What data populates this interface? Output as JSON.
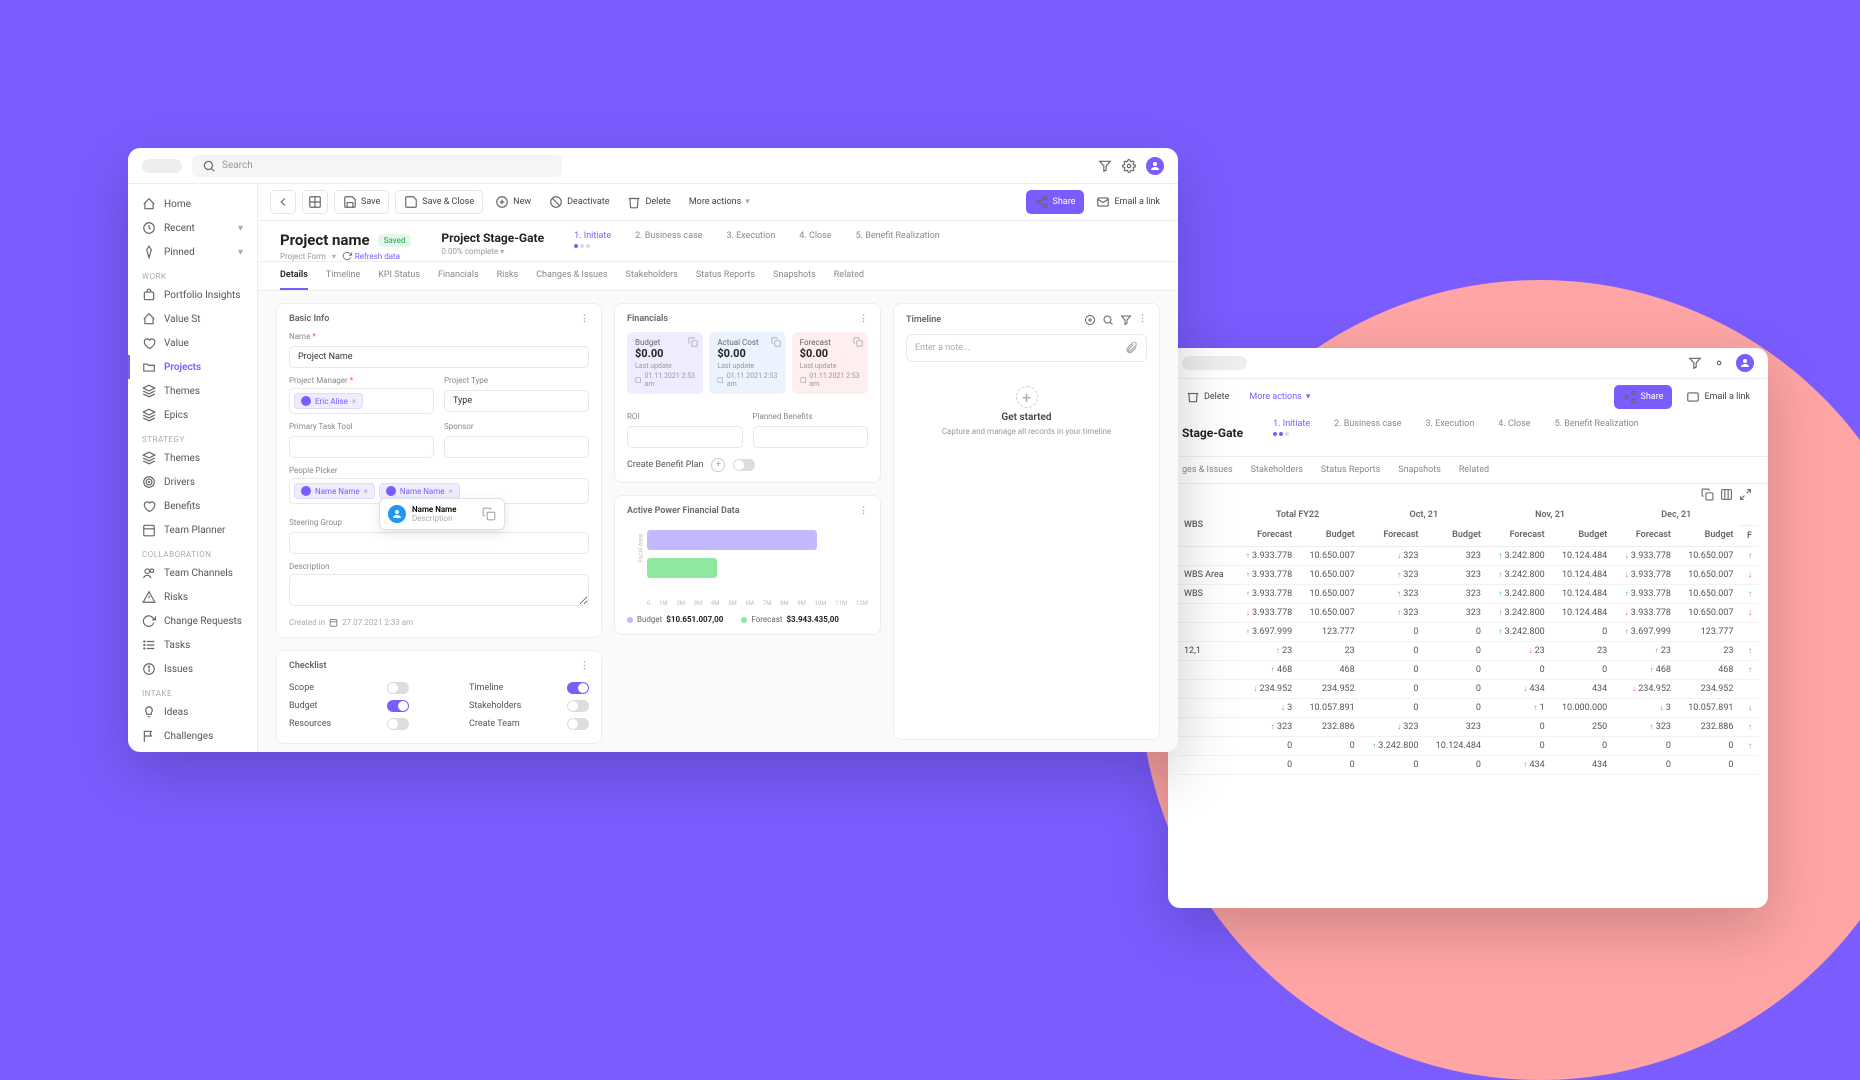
{
  "colors": {
    "accent": "#7b5cff",
    "pink": "#ffa5a5",
    "green": "#3db56a",
    "red": "#f55"
  },
  "topbar": {
    "search_placeholder": "Search"
  },
  "sidebar": {
    "top": [
      {
        "icon": "home",
        "label": "Home"
      },
      {
        "icon": "clock",
        "label": "Recent",
        "chevron": true
      },
      {
        "icon": "pin",
        "label": "Pinned",
        "chevron": true
      }
    ],
    "sections": [
      {
        "title": "WORK",
        "items": [
          {
            "icon": "bag",
            "label": "Portfolio Insights"
          },
          {
            "icon": "home",
            "label": "Value St"
          },
          {
            "icon": "heart",
            "label": "Value"
          },
          {
            "icon": "folder",
            "label": "Projects",
            "active": true
          },
          {
            "icon": "stack",
            "label": "Themes"
          },
          {
            "icon": "stack",
            "label": "Epics"
          }
        ]
      },
      {
        "title": "STRATEGY",
        "items": [
          {
            "icon": "stack",
            "label": "Themes"
          },
          {
            "icon": "target",
            "label": "Drivers"
          },
          {
            "icon": "heart",
            "label": "Benefits"
          },
          {
            "icon": "calendar",
            "label": "Team Planner"
          }
        ]
      },
      {
        "title": "COLLABORATION",
        "items": [
          {
            "icon": "users",
            "label": "Team Channels"
          },
          {
            "icon": "warn",
            "label": "Risks"
          },
          {
            "icon": "refresh",
            "label": "Change Requests"
          },
          {
            "icon": "list",
            "label": "Tasks"
          },
          {
            "icon": "info",
            "label": "Issues"
          }
        ]
      },
      {
        "title": "INTAKE",
        "items": [
          {
            "icon": "bulb",
            "label": "Ideas"
          },
          {
            "icon": "flag",
            "label": "Challenges"
          }
        ]
      }
    ]
  },
  "toolbar": {
    "save": "Save",
    "save_close": "Save & Close",
    "new": "New",
    "deactivate": "Deactivate",
    "delete": "Delete",
    "more": "More actions",
    "share": "Share",
    "email": "Email a link"
  },
  "header": {
    "title": "Project name",
    "saved_badge": "Saved",
    "form_label": "Project Form",
    "refresh": "Refresh data",
    "stage_title": "Project Stage-Gate",
    "stage_complete": "0.00% complete",
    "stages": [
      "1. Initiate",
      "2. Business case",
      "3. Execution",
      "4. Close",
      "5. Benefit Realization"
    ],
    "active_stage": 0
  },
  "tabs": [
    "Details",
    "Timeline",
    "KPI Status",
    "Financials",
    "Risks",
    "Changes & Issues",
    "Stakeholders",
    "Status Reports",
    "Snapshots",
    "Related"
  ],
  "active_tab": 0,
  "basic_info": {
    "title": "Basic Info",
    "name_label": "Name",
    "name_value": "Project Name",
    "pm_label": "Project Manager",
    "pm_chip": "Eric Alise",
    "type_label": "Project Type",
    "type_value": "Type",
    "task_tool_label": "Primary Task Tool",
    "sponsor_label": "Sponsor",
    "people_label": "People Picker",
    "people_chips": [
      "Name Name",
      "Name Name"
    ],
    "popup": {
      "name": "Name Name",
      "desc": "Description"
    },
    "steering_label": "Steering Group",
    "desc_label": "Description",
    "created_label": "Created in",
    "created_value": "27.07.2021 2:33 am"
  },
  "checklist": {
    "title": "Checklist",
    "rows": [
      {
        "l": "Scope",
        "lon": false,
        "r": "Timeline",
        "ron": true
      },
      {
        "l": "Budget",
        "lon": true,
        "r": "Stakeholders",
        "ron": false
      },
      {
        "l": "Resources",
        "lon": false,
        "r": "Create Team",
        "ron": false
      }
    ]
  },
  "financials": {
    "title": "Financials",
    "cards": [
      {
        "kind": "budget",
        "label": "Budget",
        "value": "$0.00",
        "updated": "01.11.2021  2:53 am"
      },
      {
        "kind": "actual",
        "label": "Actual Cost",
        "value": "$0.00",
        "updated": "01.11.2021  2:53 am"
      },
      {
        "kind": "forecast",
        "label": "Forecast",
        "value": "$0.00",
        "updated": "01.11.2021  2:53 am"
      }
    ],
    "roi_label": "ROI",
    "pb_label": "Planned Benefits",
    "create_benefit": "Create Benefit Plan"
  },
  "active_power": {
    "title": "Active Power Financial Data",
    "budget_label": "Budget",
    "budget_value": "$10.651.007,00",
    "forecast_label": "Forecast",
    "forecast_value": "$3.943.435,00",
    "axis": [
      "0",
      "1M",
      "2M",
      "3M",
      "4M",
      "5M",
      "6M",
      "7M",
      "8M",
      "9M",
      "10M",
      "11M",
      "12M"
    ],
    "ylabel": "Focal Area"
  },
  "chart_data": {
    "type": "bar",
    "orientation": "horizontal",
    "title": "Active Power Financial Data",
    "categories": [
      "Budget",
      "Forecast"
    ],
    "values": [
      10651007,
      3943435
    ],
    "colors": [
      "#c5b8ff",
      "#8ee89e"
    ],
    "xlabel": "",
    "ylabel": "Focal Area",
    "xlim": [
      0,
      12000000
    ],
    "xticks": [
      "0",
      "1M",
      "2M",
      "3M",
      "4M",
      "5M",
      "6M",
      "7M",
      "8M",
      "9M",
      "10M",
      "11M",
      "12M"
    ]
  },
  "timeline": {
    "title": "Timeline",
    "placeholder": "Enter a note...",
    "empty_title": "Get started",
    "empty_sub": "Capture and manage all records in your timeline"
  },
  "back": {
    "toolbar": {
      "delete": "Delete",
      "more": "More actions",
      "share": "Share",
      "email": "Email a link"
    },
    "stage_title": "Stage-Gate",
    "stages": [
      "1. Initiate",
      "2. Business case",
      "3. Execution",
      "4. Close",
      "5. Benefit Realization"
    ],
    "tabs_visible": [
      "ges & Issues",
      "Stakeholders",
      "Status Reports",
      "Snapshots",
      "Related"
    ],
    "grid": {
      "row_header": "WBS",
      "groups": [
        "Total FY22",
        "Oct, 21",
        "Nov, 21",
        "Dec, 21"
      ],
      "sub": [
        "Forecast",
        "Budget"
      ],
      "labels": [
        "",
        "WBS Area",
        "WBS",
        "",
        "",
        "12,1",
        "",
        "",
        "",
        "",
        "",
        ""
      ],
      "rows": [
        [
          {
            "v": "3.933.778",
            "d": "u"
          },
          {
            "v": "10.650.007"
          },
          {
            "v": "323",
            "d": "d"
          },
          {
            "v": "323"
          },
          {
            "v": "3.242.800",
            "d": "u"
          },
          {
            "v": "10.124.484"
          },
          {
            "v": "3.933.778",
            "d": "d"
          },
          {
            "v": "10.650.007"
          },
          {
            "v": "",
            "d": "u"
          }
        ],
        [
          {
            "v": "3.933.778",
            "d": "u"
          },
          {
            "v": "10.650.007"
          },
          {
            "v": "323",
            "d": "u"
          },
          {
            "v": "323"
          },
          {
            "v": "3.242.800",
            "d": "u"
          },
          {
            "v": "10.124.484"
          },
          {
            "v": "3.933.778",
            "d": "d"
          },
          {
            "v": "10.650.007"
          },
          {
            "v": "",
            "d": "d"
          }
        ],
        [
          {
            "v": "3.933.778",
            "d": "u"
          },
          {
            "v": "10.650.007"
          },
          {
            "v": "323",
            "d": "u"
          },
          {
            "v": "323"
          },
          {
            "v": "3.242.800",
            "d": "u"
          },
          {
            "v": "10.124.484"
          },
          {
            "v": "3.933.778",
            "d": "u"
          },
          {
            "v": "10.650.007"
          },
          {
            "v": "",
            "d": "u"
          }
        ],
        [
          {
            "v": "3.933.778",
            "d": "d"
          },
          {
            "v": "10.650.007"
          },
          {
            "v": "323",
            "d": "u"
          },
          {
            "v": "323"
          },
          {
            "v": "3.242.800",
            "d": "u"
          },
          {
            "v": "10.124.484"
          },
          {
            "v": "3.933.778",
            "d": "d"
          },
          {
            "v": "10.650.007"
          },
          {
            "v": "",
            "d": "d"
          }
        ],
        [
          {
            "v": "3.697.999",
            "d": "u"
          },
          {
            "v": "123.777"
          },
          {
            "v": "0"
          },
          {
            "v": "0"
          },
          {
            "v": "3.242.800",
            "d": "u"
          },
          {
            "v": "0"
          },
          {
            "v": "3.697.999",
            "d": "u"
          },
          {
            "v": "123.777"
          },
          {
            "v": ""
          }
        ],
        [
          {
            "v": "23",
            "d": "u"
          },
          {
            "v": "23"
          },
          {
            "v": "0"
          },
          {
            "v": "0"
          },
          {
            "v": "23",
            "d": "d"
          },
          {
            "v": "23"
          },
          {
            "v": "23",
            "d": "u"
          },
          {
            "v": "23"
          },
          {
            "v": "",
            "d": "u"
          }
        ],
        [
          {
            "v": "468",
            "d": "u"
          },
          {
            "v": "468"
          },
          {
            "v": "0"
          },
          {
            "v": "0"
          },
          {
            "v": "0"
          },
          {
            "v": "0"
          },
          {
            "v": "468",
            "d": "u"
          },
          {
            "v": "468"
          },
          {
            "v": "",
            "d": "u"
          }
        ],
        [
          {
            "v": "234.952",
            "d": "d"
          },
          {
            "v": "234.952"
          },
          {
            "v": "0"
          },
          {
            "v": "0"
          },
          {
            "v": "434",
            "d": "d"
          },
          {
            "v": "434"
          },
          {
            "v": "234.952",
            "d": "d"
          },
          {
            "v": "234.952"
          },
          {
            "v": ""
          }
        ],
        [
          {
            "v": "3",
            "d": "d"
          },
          {
            "v": "10.057.891"
          },
          {
            "v": "0"
          },
          {
            "v": "0"
          },
          {
            "v": "1",
            "d": "u"
          },
          {
            "v": "10.000.000"
          },
          {
            "v": "3",
            "d": "d"
          },
          {
            "v": "10.057.891"
          },
          {
            "v": "",
            "d": "d"
          }
        ],
        [
          {
            "v": "323",
            "d": "u"
          },
          {
            "v": "232.886"
          },
          {
            "v": "323",
            "d": "d"
          },
          {
            "v": "323"
          },
          {
            "v": "0"
          },
          {
            "v": "250"
          },
          {
            "v": "323",
            "d": "u"
          },
          {
            "v": "232.886"
          },
          {
            "v": "",
            "d": "u"
          }
        ],
        [
          {
            "v": "0"
          },
          {
            "v": "0"
          },
          {
            "v": "3.242.800",
            "d": "u"
          },
          {
            "v": "10.124.484"
          },
          {
            "v": "0"
          },
          {
            "v": "0"
          },
          {
            "v": "0"
          },
          {
            "v": "0"
          },
          {
            "v": "",
            "d": "u"
          }
        ],
        [
          {
            "v": "0"
          },
          {
            "v": "0"
          },
          {
            "v": "0"
          },
          {
            "v": "0"
          },
          {
            "v": "434",
            "d": "u"
          },
          {
            "v": "434"
          },
          {
            "v": "0"
          },
          {
            "v": "0"
          },
          {
            "v": ""
          }
        ]
      ]
    }
  }
}
